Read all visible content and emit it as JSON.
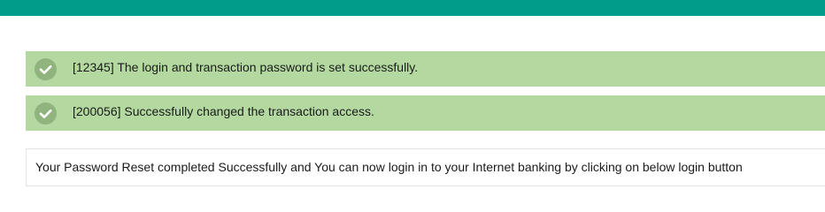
{
  "colors": {
    "header_bar": "#009e8a",
    "success_background": "#b3d9a0",
    "check_icon": "#8fb47e"
  },
  "alerts": [
    {
      "icon": "check-circle-icon",
      "message": "[12345] The login and transaction password is set successfully."
    },
    {
      "icon": "check-circle-icon",
      "message": "[200056] Successfully changed the transaction access."
    }
  ],
  "info": {
    "message": "Your Password Reset completed Successfully and You can now login in to your Internet banking by clicking on below login button"
  }
}
